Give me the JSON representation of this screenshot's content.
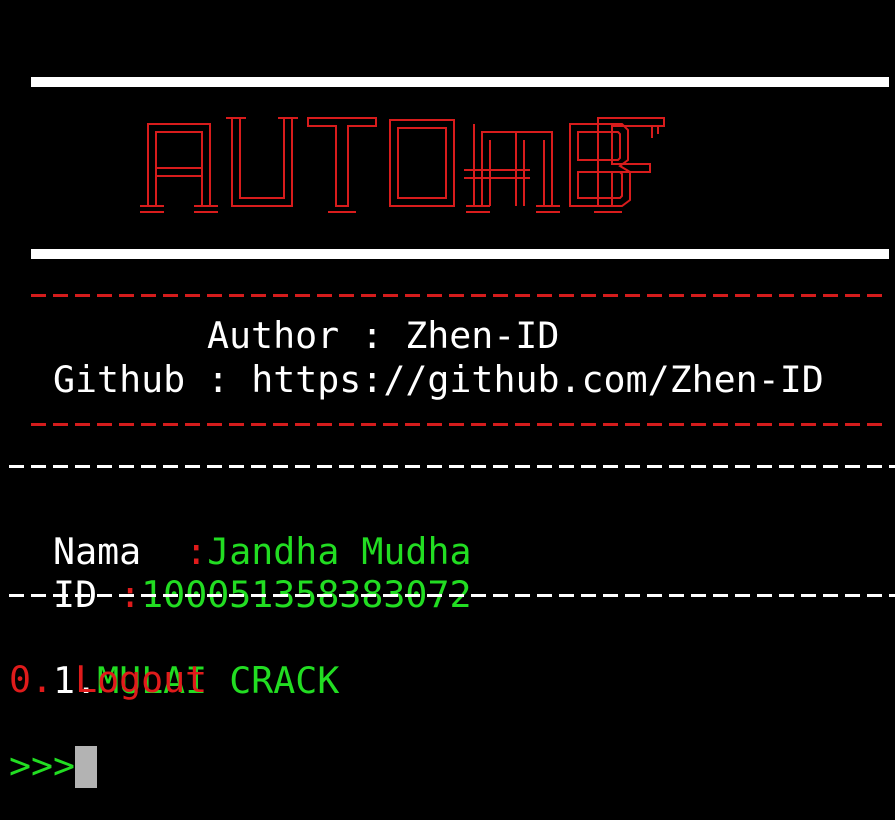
{
  "banner": {
    "logo_text": "AUTO-MBF"
  },
  "info": {
    "author": "Author : Zhen-ID",
    "github": "Github : https://github.com/Zhen-ID"
  },
  "account": {
    "name_label": "Nama  ",
    "name_sep": ":",
    "name_value": "Jandha Mudha",
    "id_label": "ID ",
    "id_sep": ":",
    "id_value": "100051358383072"
  },
  "menu": {
    "item1_num": "1.",
    "item1_label": "MULAI CRACK",
    "item0_label": "0. Logout"
  },
  "prompt": {
    "symbol": ">>>"
  },
  "colors": {
    "background": "#000000",
    "red": "#e01b1b",
    "green": "#22dd22",
    "white": "#ffffff",
    "cursor": "#b3b3b3"
  }
}
